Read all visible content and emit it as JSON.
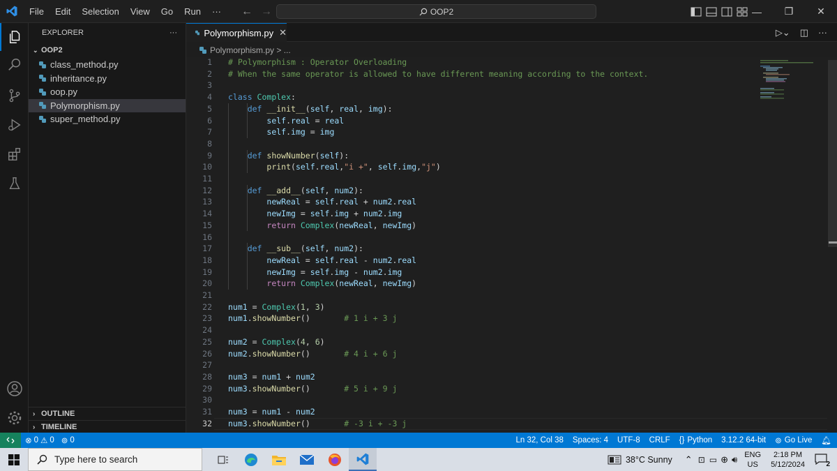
{
  "titlebar": {
    "menu": [
      "File",
      "Edit",
      "Selection",
      "View",
      "Go",
      "Run",
      "···"
    ],
    "search": "OOP2",
    "win_controls": [
      "minimize-icon",
      "restore-icon",
      "close-icon"
    ]
  },
  "activity_bar": [
    "explorer-icon",
    "search-icon",
    "source-control-icon",
    "run-debug-icon",
    "extensions-icon",
    "testing-icon",
    "accounts-icon",
    "manage-gear-icon"
  ],
  "sidebar": {
    "title": "EXPLORER",
    "more": "···",
    "folder": "OOP2",
    "files": [
      "class_method.py",
      "inheritance.py",
      "oop.py",
      "Polymorphism.py",
      "super_method.py"
    ],
    "active_file_index": 3,
    "outline": "OUTLINE",
    "timeline": "TIMELINE"
  },
  "editor": {
    "tab": "Polymorphism.py",
    "breadcrumb": "Polymorphism.py > ...",
    "lines": [
      [
        {
          "t": "# Polymorphism : Operator Overloading",
          "c": "com"
        }
      ],
      [
        {
          "t": "# When the same operator is allowed to have different meaning according to the context.",
          "c": "com"
        }
      ],
      [],
      [
        {
          "t": "class ",
          "c": "kw"
        },
        {
          "t": "Complex",
          "c": "cls"
        },
        {
          "t": ":",
          "c": ""
        }
      ],
      [
        {
          "t": "    ",
          "c": ""
        },
        {
          "t": "def ",
          "c": "kw"
        },
        {
          "t": "__init__",
          "c": "fn"
        },
        {
          "t": "(",
          "c": ""
        },
        {
          "t": "self",
          "c": "var"
        },
        {
          "t": ", ",
          "c": ""
        },
        {
          "t": "real",
          "c": "var"
        },
        {
          "t": ", ",
          "c": ""
        },
        {
          "t": "img",
          "c": "var"
        },
        {
          "t": "):",
          "c": ""
        }
      ],
      [
        {
          "t": "        ",
          "c": ""
        },
        {
          "t": "self",
          "c": "var"
        },
        {
          "t": ".",
          "c": ""
        },
        {
          "t": "real",
          "c": "var"
        },
        {
          "t": " = ",
          "c": ""
        },
        {
          "t": "real",
          "c": "var"
        }
      ],
      [
        {
          "t": "        ",
          "c": ""
        },
        {
          "t": "self",
          "c": "var"
        },
        {
          "t": ".",
          "c": ""
        },
        {
          "t": "img",
          "c": "var"
        },
        {
          "t": " = ",
          "c": ""
        },
        {
          "t": "img",
          "c": "var"
        }
      ],
      [],
      [
        {
          "t": "    ",
          "c": ""
        },
        {
          "t": "def ",
          "c": "kw"
        },
        {
          "t": "showNumber",
          "c": "fn"
        },
        {
          "t": "(",
          "c": ""
        },
        {
          "t": "self",
          "c": "var"
        },
        {
          "t": "):",
          "c": ""
        }
      ],
      [
        {
          "t": "        ",
          "c": ""
        },
        {
          "t": "print",
          "c": "fn"
        },
        {
          "t": "(",
          "c": ""
        },
        {
          "t": "self",
          "c": "var"
        },
        {
          "t": ".",
          "c": ""
        },
        {
          "t": "real",
          "c": "var"
        },
        {
          "t": ",",
          "c": ""
        },
        {
          "t": "\"i +\"",
          "c": "str"
        },
        {
          "t": ", ",
          "c": ""
        },
        {
          "t": "self",
          "c": "var"
        },
        {
          "t": ".",
          "c": ""
        },
        {
          "t": "img",
          "c": "var"
        },
        {
          "t": ",",
          "c": ""
        },
        {
          "t": "\"j\"",
          "c": "str"
        },
        {
          "t": ")",
          "c": ""
        }
      ],
      [],
      [
        {
          "t": "    ",
          "c": ""
        },
        {
          "t": "def ",
          "c": "kw"
        },
        {
          "t": "__add__",
          "c": "fn"
        },
        {
          "t": "(",
          "c": ""
        },
        {
          "t": "self",
          "c": "var"
        },
        {
          "t": ", ",
          "c": ""
        },
        {
          "t": "num2",
          "c": "var"
        },
        {
          "t": "):",
          "c": ""
        }
      ],
      [
        {
          "t": "        ",
          "c": ""
        },
        {
          "t": "newReal",
          "c": "var"
        },
        {
          "t": " = ",
          "c": ""
        },
        {
          "t": "self",
          "c": "var"
        },
        {
          "t": ".",
          "c": ""
        },
        {
          "t": "real",
          "c": "var"
        },
        {
          "t": " + ",
          "c": ""
        },
        {
          "t": "num2",
          "c": "var"
        },
        {
          "t": ".",
          "c": ""
        },
        {
          "t": "real",
          "c": "var"
        }
      ],
      [
        {
          "t": "        ",
          "c": ""
        },
        {
          "t": "newImg",
          "c": "var"
        },
        {
          "t": " = ",
          "c": ""
        },
        {
          "t": "self",
          "c": "var"
        },
        {
          "t": ".",
          "c": ""
        },
        {
          "t": "img",
          "c": "var"
        },
        {
          "t": " + ",
          "c": ""
        },
        {
          "t": "num2",
          "c": "var"
        },
        {
          "t": ".",
          "c": ""
        },
        {
          "t": "img",
          "c": "var"
        }
      ],
      [
        {
          "t": "        ",
          "c": ""
        },
        {
          "t": "return ",
          "c": "ctl"
        },
        {
          "t": "Complex",
          "c": "cls"
        },
        {
          "t": "(",
          "c": ""
        },
        {
          "t": "newReal",
          "c": "var"
        },
        {
          "t": ", ",
          "c": ""
        },
        {
          "t": "newImg",
          "c": "var"
        },
        {
          "t": ")",
          "c": ""
        }
      ],
      [],
      [
        {
          "t": "    ",
          "c": ""
        },
        {
          "t": "def ",
          "c": "kw"
        },
        {
          "t": "__sub__",
          "c": "fn"
        },
        {
          "t": "(",
          "c": ""
        },
        {
          "t": "self",
          "c": "var"
        },
        {
          "t": ", ",
          "c": ""
        },
        {
          "t": "num2",
          "c": "var"
        },
        {
          "t": "):",
          "c": ""
        }
      ],
      [
        {
          "t": "        ",
          "c": ""
        },
        {
          "t": "newReal",
          "c": "var"
        },
        {
          "t": " = ",
          "c": ""
        },
        {
          "t": "self",
          "c": "var"
        },
        {
          "t": ".",
          "c": ""
        },
        {
          "t": "real",
          "c": "var"
        },
        {
          "t": " - ",
          "c": ""
        },
        {
          "t": "num2",
          "c": "var"
        },
        {
          "t": ".",
          "c": ""
        },
        {
          "t": "real",
          "c": "var"
        }
      ],
      [
        {
          "t": "        ",
          "c": ""
        },
        {
          "t": "newImg",
          "c": "var"
        },
        {
          "t": " = ",
          "c": ""
        },
        {
          "t": "self",
          "c": "var"
        },
        {
          "t": ".",
          "c": ""
        },
        {
          "t": "img",
          "c": "var"
        },
        {
          "t": " - ",
          "c": ""
        },
        {
          "t": "num2",
          "c": "var"
        },
        {
          "t": ".",
          "c": ""
        },
        {
          "t": "img",
          "c": "var"
        }
      ],
      [
        {
          "t": "        ",
          "c": ""
        },
        {
          "t": "return ",
          "c": "ctl"
        },
        {
          "t": "Complex",
          "c": "cls"
        },
        {
          "t": "(",
          "c": ""
        },
        {
          "t": "newReal",
          "c": "var"
        },
        {
          "t": ", ",
          "c": ""
        },
        {
          "t": "newImg",
          "c": "var"
        },
        {
          "t": ")",
          "c": ""
        }
      ],
      [],
      [
        {
          "t": "num1",
          "c": "var"
        },
        {
          "t": " = ",
          "c": ""
        },
        {
          "t": "Complex",
          "c": "cls"
        },
        {
          "t": "(",
          "c": ""
        },
        {
          "t": "1",
          "c": "num"
        },
        {
          "t": ", ",
          "c": ""
        },
        {
          "t": "3",
          "c": "num"
        },
        {
          "t": ")",
          "c": ""
        }
      ],
      [
        {
          "t": "num1",
          "c": "var"
        },
        {
          "t": ".",
          "c": ""
        },
        {
          "t": "showNumber",
          "c": "fn"
        },
        {
          "t": "()       ",
          "c": ""
        },
        {
          "t": "# 1 i + 3 j",
          "c": "com"
        }
      ],
      [],
      [
        {
          "t": "num2",
          "c": "var"
        },
        {
          "t": " = ",
          "c": ""
        },
        {
          "t": "Complex",
          "c": "cls"
        },
        {
          "t": "(",
          "c": ""
        },
        {
          "t": "4",
          "c": "num"
        },
        {
          "t": ", ",
          "c": ""
        },
        {
          "t": "6",
          "c": "num"
        },
        {
          "t": ")",
          "c": ""
        }
      ],
      [
        {
          "t": "num2",
          "c": "var"
        },
        {
          "t": ".",
          "c": ""
        },
        {
          "t": "showNumber",
          "c": "fn"
        },
        {
          "t": "()       ",
          "c": ""
        },
        {
          "t": "# 4 i + 6 j",
          "c": "com"
        }
      ],
      [],
      [
        {
          "t": "num3",
          "c": "var"
        },
        {
          "t": " = ",
          "c": ""
        },
        {
          "t": "num1",
          "c": "var"
        },
        {
          "t": " + ",
          "c": ""
        },
        {
          "t": "num2",
          "c": "var"
        }
      ],
      [
        {
          "t": "num3",
          "c": "var"
        },
        {
          "t": ".",
          "c": ""
        },
        {
          "t": "showNumber",
          "c": "fn"
        },
        {
          "t": "()       ",
          "c": ""
        },
        {
          "t": "# 5 i + 9 j",
          "c": "com"
        }
      ],
      [],
      [
        {
          "t": "num3",
          "c": "var"
        },
        {
          "t": " = ",
          "c": ""
        },
        {
          "t": "num1",
          "c": "var"
        },
        {
          "t": " - ",
          "c": ""
        },
        {
          "t": "num2",
          "c": "var"
        }
      ],
      [
        {
          "t": "num3",
          "c": "var"
        },
        {
          "t": ".",
          "c": ""
        },
        {
          "t": "showNumber",
          "c": "fn"
        },
        {
          "t": "()       ",
          "c": ""
        },
        {
          "t": "# -3 i + -3 j",
          "c": "com"
        }
      ]
    ],
    "current_line": 32
  },
  "statusbar": {
    "errors": "0",
    "warnings": "0",
    "ports": "0",
    "position": "Ln 32, Col 38",
    "spaces": "Spaces: 4",
    "encoding": "UTF-8",
    "eol": "CRLF",
    "language": "Python",
    "interpreter": "3.12.2 64-bit",
    "golive": "Go Live"
  },
  "taskbar": {
    "search_placeholder": "Type here to search",
    "weather": "38°C  Sunny",
    "lang_top": "ENG",
    "lang_bottom": "US",
    "time": "2:18 PM",
    "date": "5/12/2024",
    "notifications": "2"
  },
  "colors": {
    "accent": "#0078d4",
    "status_remote": "#16825d",
    "python_file_icon": "#519aba"
  }
}
